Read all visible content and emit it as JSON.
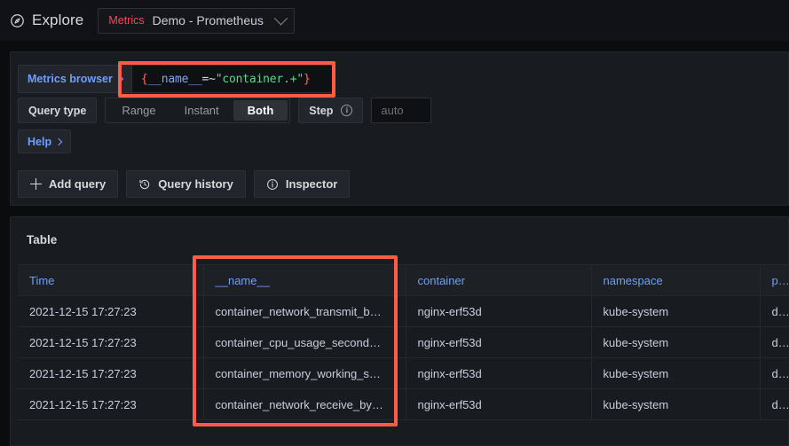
{
  "topbar": {
    "app_title": "Explore",
    "compass_icon": "compass-icon",
    "datasource": {
      "type_label": "Metrics",
      "name": "Demo - Prometheus",
      "chevron_icon": "chevron-down-icon"
    }
  },
  "query_panel": {
    "metrics_browser_label": "Metrics browser",
    "metrics_browser_chevron": "chevron-right-icon",
    "query_expression": "{__name__=~\"container.+\"}",
    "query_tokens": {
      "open_brace": "{",
      "label": "__name__",
      "operator": "=~",
      "value": "\"container.+\"",
      "close_brace": "}"
    },
    "query_type_label": "Query type",
    "query_type_options": [
      "Range",
      "Instant",
      "Both"
    ],
    "query_type_selected": "Both",
    "step_label": "Step",
    "step_info_icon": "info-circle-icon",
    "step_value": "",
    "step_placeholder": "auto",
    "help_label": "Help",
    "help_chevron": "chevron-right-icon",
    "actions": [
      {
        "label": "Add query",
        "icon": "plus-icon"
      },
      {
        "label": "Query history",
        "icon": "history-icon"
      },
      {
        "label": "Inspector",
        "icon": "info-circle-icon"
      }
    ]
  },
  "table_panel": {
    "title": "Table",
    "columns": [
      "Time",
      "__name__",
      "container",
      "namespace",
      "p"
    ],
    "rows": [
      [
        "2021-12-15 17:27:23",
        "container_network_transmit_b…",
        "nginx-erf53d",
        "kube-system",
        "d"
      ],
      [
        "2021-12-15 17:27:23",
        "container_cpu_usage_second…",
        "nginx-erf53d",
        "kube-system",
        "d"
      ],
      [
        "2021-12-15 17:27:23",
        "container_memory_working_s…",
        "nginx-erf53d",
        "kube-system",
        "d"
      ],
      [
        "2021-12-15 17:27:23",
        "container_network_receive_by…",
        "nginx-erf53d",
        "kube-system",
        "d"
      ]
    ]
  },
  "annotations": {
    "highlight_color": "#FF5B47",
    "boxes": [
      {
        "name": "query-expression-highlight"
      },
      {
        "name": "name-column-highlight"
      }
    ]
  }
}
